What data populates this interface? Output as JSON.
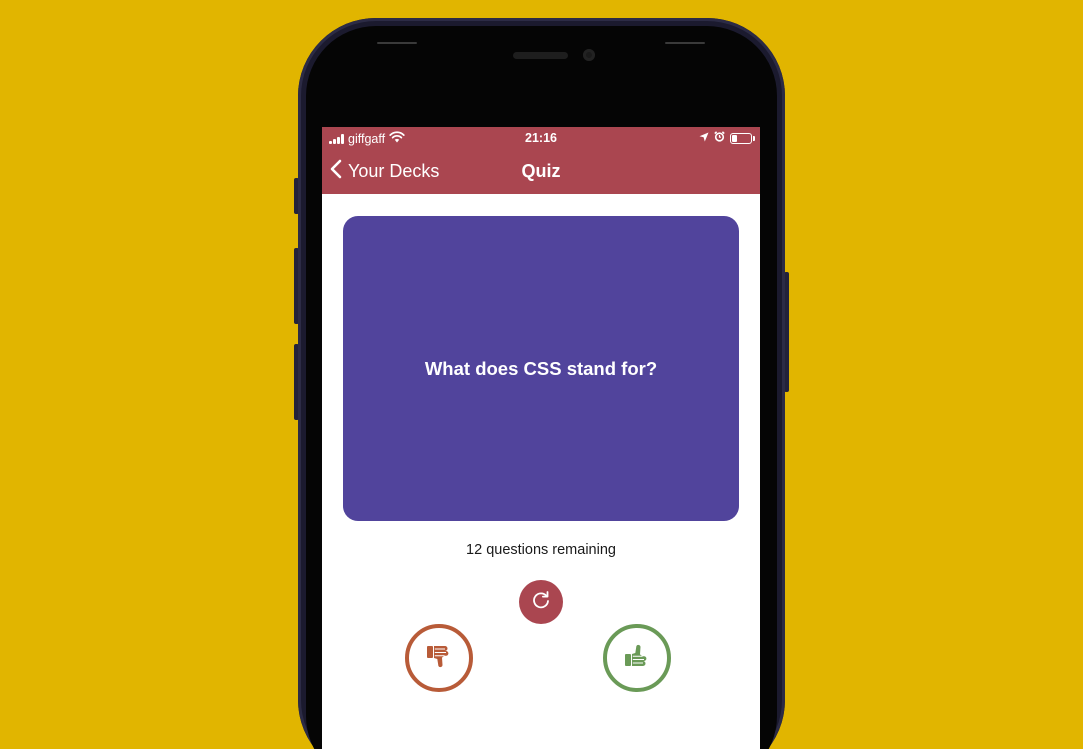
{
  "status_bar": {
    "carrier": "giffgaff",
    "time": "21:16",
    "battery_level": 0.3
  },
  "nav": {
    "back_label": "Your Decks",
    "title": "Quiz"
  },
  "card": {
    "question": "What does CSS stand for?"
  },
  "progress": {
    "remaining_text": "12 questions remaining"
  },
  "icons": {
    "refresh": "refresh-icon",
    "thumbs_down": "thumbs-down-icon",
    "thumbs_up": "thumbs-up-icon"
  },
  "colors": {
    "background": "#E1B500",
    "accent": "#AA4650",
    "card": "#51449C",
    "incorrect": "#B85B38",
    "correct": "#6A9A57"
  }
}
